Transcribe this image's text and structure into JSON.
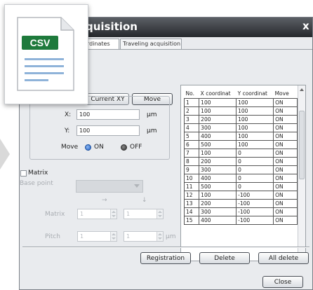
{
  "window": {
    "title": "quisition",
    "close_glyph": "x"
  },
  "tabs": [
    {
      "label": "rdinates",
      "active": true
    },
    {
      "label": "Traveling acquisition",
      "active": false
    }
  ],
  "position": {
    "current_xy_label": "Current XY",
    "move_label": "Move",
    "x_label": "X:",
    "x_value": "100",
    "y_label": "Y:",
    "y_value": "100",
    "unit": "µm",
    "move_mode_label": "Move",
    "on_label": "ON",
    "off_label": "OFF",
    "move_selected": "ON"
  },
  "matrix": {
    "checkbox_label": "Matrix",
    "checked": false,
    "base_point_label": "Base point",
    "arrow_right": "→",
    "arrow_down": "↓",
    "matrix_label": "Matrix",
    "matrix_x": "1",
    "matrix_y": "1",
    "pitch_label": "Pitch",
    "pitch_x": "1",
    "pitch_y": "1",
    "pitch_unit": "µm"
  },
  "table": {
    "columns": [
      "No.",
      "X coordinat",
      "Y coordinat",
      "Move"
    ],
    "rows": [
      [
        "1",
        "100",
        "100",
        "ON"
      ],
      [
        "2",
        "100",
        "100",
        "ON"
      ],
      [
        "3",
        "200",
        "100",
        "ON"
      ],
      [
        "4",
        "300",
        "100",
        "ON"
      ],
      [
        "5",
        "400",
        "100",
        "ON"
      ],
      [
        "6",
        "500",
        "100",
        "ON"
      ],
      [
        "7",
        "100",
        "0",
        "ON"
      ],
      [
        "8",
        "200",
        "0",
        "ON"
      ],
      [
        "9",
        "300",
        "0",
        "ON"
      ],
      [
        "10",
        "400",
        "0",
        "ON"
      ],
      [
        "11",
        "500",
        "0",
        "ON"
      ],
      [
        "12",
        "100",
        "-100",
        "ON"
      ],
      [
        "13",
        "200",
        "-100",
        "ON"
      ],
      [
        "14",
        "300",
        "-100",
        "ON"
      ],
      [
        "15",
        "400",
        "-100",
        "ON"
      ]
    ]
  },
  "actions": {
    "registration_label": "Registration",
    "delete_label": "Delete",
    "all_delete_label": "All delete",
    "close_label": "Close"
  },
  "overlay": {
    "file_type": "CSV",
    "badge_color": "#1e7a3c",
    "line_color": "#8fb3d9",
    "icon": "csv-file-icon"
  }
}
